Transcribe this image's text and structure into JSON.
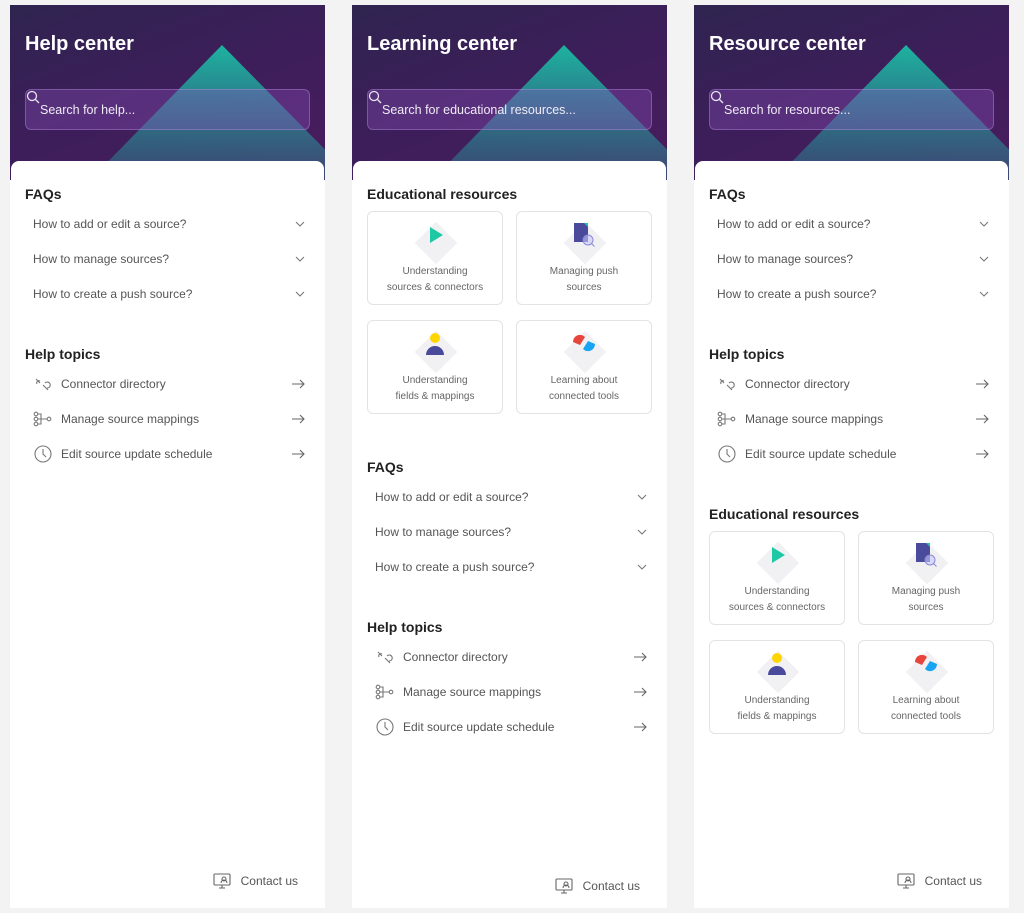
{
  "panels": [
    {
      "title": "Help center",
      "search_placeholder": "Search for help...",
      "sections": [
        {
          "type": "faq",
          "heading": "FAQs",
          "items": [
            "How to add or edit a source?",
            "How to manage sources?",
            "How to create a push source?"
          ]
        },
        {
          "type": "topics",
          "heading": "Help topics",
          "items": [
            {
              "label": "Connector directory",
              "icon": "connector-icon"
            },
            {
              "label": "Manage source mappings",
              "icon": "mapping-icon"
            },
            {
              "label": "Edit source update schedule",
              "icon": "clock-icon"
            }
          ]
        }
      ],
      "contact": "Contact us"
    },
    {
      "title": "Learning center",
      "search_placeholder": "Search for educational resources...",
      "sections": [
        {
          "type": "edu",
          "heading": "Educational resources",
          "items": [
            {
              "line1": "Understanding",
              "line2": "sources & connectors",
              "icon": "play-icon"
            },
            {
              "line1": "Managing push",
              "line2": "sources",
              "icon": "document-search-icon"
            },
            {
              "line1": "Understanding",
              "line2": "fields & mappings",
              "icon": "user-icon"
            },
            {
              "line1": "Learning about",
              "line2": "connected tools",
              "icon": "plug-icon"
            }
          ]
        },
        {
          "type": "faq",
          "heading": "FAQs",
          "items": [
            "How to add or edit a source?",
            "How to manage sources?",
            "How to create a push source?"
          ]
        },
        {
          "type": "topics",
          "heading": "Help topics",
          "items": [
            {
              "label": "Connector directory",
              "icon": "connector-icon"
            },
            {
              "label": "Manage source mappings",
              "icon": "mapping-icon"
            },
            {
              "label": "Edit source update schedule",
              "icon": "clock-icon"
            }
          ]
        }
      ],
      "contact": "Contact us"
    },
    {
      "title": "Resource center",
      "search_placeholder": "Search for resources...",
      "sections": [
        {
          "type": "faq",
          "heading": "FAQs",
          "items": [
            "How to add or edit a source?",
            "How to manage sources?",
            "How to create a push source?"
          ]
        },
        {
          "type": "topics",
          "heading": "Help topics",
          "items": [
            {
              "label": "Connector directory",
              "icon": "connector-icon"
            },
            {
              "label": "Manage source mappings",
              "icon": "mapping-icon"
            },
            {
              "label": "Edit source update schedule",
              "icon": "clock-icon"
            }
          ]
        },
        {
          "type": "edu",
          "heading": "Educational resources",
          "items": [
            {
              "line1": "Understanding",
              "line2": "sources & connectors",
              "icon": "play-icon"
            },
            {
              "line1": "Managing push",
              "line2": "sources",
              "icon": "document-search-icon"
            },
            {
              "line1": "Understanding",
              "line2": "fields & mappings",
              "icon": "user-icon"
            },
            {
              "line1": "Learning about",
              "line2": "connected tools",
              "icon": "plug-icon"
            }
          ]
        }
      ],
      "contact": "Contact us"
    }
  ],
  "colors": {
    "hero": "#3d1e5a",
    "accent": "#1fb5a0"
  }
}
